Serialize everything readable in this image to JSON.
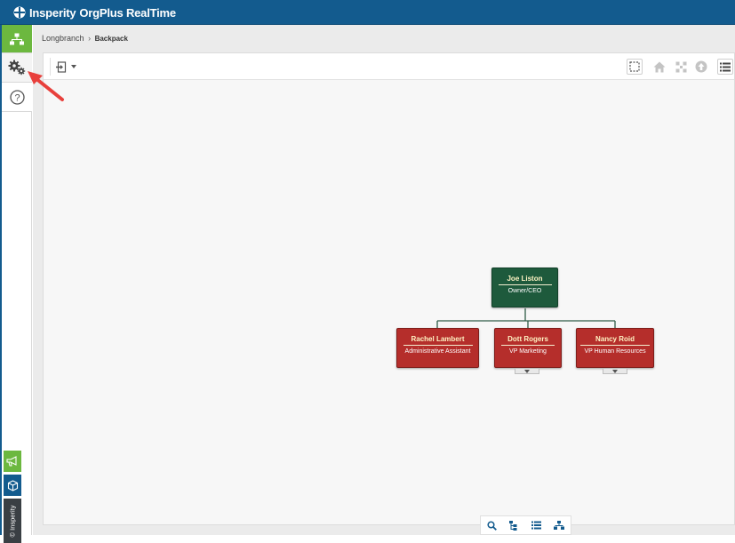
{
  "app": {
    "brand_name": "Insperity",
    "product_name": "OrgPlus RealTime",
    "brand_color": "#135b8e",
    "accent_color": "#6cb83f"
  },
  "left_nav": {
    "items": [
      {
        "name": "org-chart-view",
        "icon": "org-chart-icon",
        "active": true
      },
      {
        "name": "settings",
        "icon": "gears-icon",
        "active": false
      },
      {
        "name": "help",
        "icon": "help-circle-icon",
        "active": false
      }
    ],
    "side_tabs": [
      {
        "name": "feedback",
        "icon": "megaphone-icon"
      },
      {
        "name": "insperity-box",
        "icon": "box-icon"
      },
      {
        "name": "copyright",
        "label": "© Insperity"
      }
    ]
  },
  "breadcrumb": {
    "items": [
      "Longbranch",
      "Backpack"
    ],
    "separator": "›"
  },
  "toolbar": {
    "export_icon": "export-icon",
    "right_tools": [
      "select-marquee-icon",
      "home-icon",
      "fit-screen-icon",
      "up-level-icon",
      "list-icon"
    ]
  },
  "org_chart": {
    "root": {
      "name": "Joe Liston",
      "title": "Owner/CEO",
      "color": "#1e5a3c"
    },
    "children": [
      {
        "name": "Rachel Lambert",
        "title": "Administrative Assistant",
        "color": "#b52e2b",
        "has_reports": false
      },
      {
        "name": "Dott Rogers",
        "title": "VP Marketing",
        "color": "#b52e2b",
        "has_reports": true
      },
      {
        "name": "Nancy Roid",
        "title": "VP Human Resources",
        "color": "#b52e2b",
        "has_reports": true
      }
    ]
  },
  "view_switcher": {
    "icons": [
      "search-icon",
      "tree-view-icon",
      "list-view-icon",
      "org-chart-view-icon"
    ]
  }
}
